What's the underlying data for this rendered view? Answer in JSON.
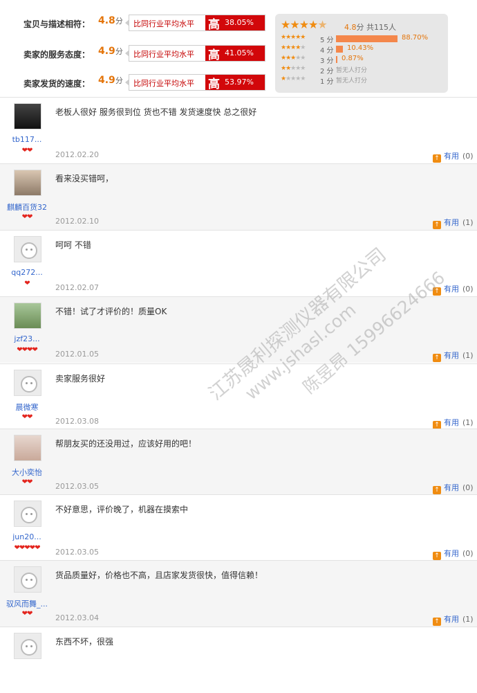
{
  "summary": {
    "metrics": [
      {
        "label": "宝贝与描述相符：",
        "score": "4.8",
        "unit": "分",
        "compare": "比同行业平均水平",
        "level": "高",
        "pct": "38.05%"
      },
      {
        "label": "卖家的服务态度：",
        "score": "4.9",
        "unit": "分",
        "compare": "比同行业平均水平",
        "level": "高",
        "pct": "41.05%"
      },
      {
        "label": "卖家发货的速度：",
        "score": "4.9",
        "unit": "分",
        "compare": "比同行业平均水平",
        "level": "高",
        "pct": "53.97%"
      }
    ],
    "rating": {
      "avg": "4.8",
      "avg_unit": "分",
      "count_text": "共115人",
      "distribution": [
        {
          "label": "5 分",
          "pct": "88.70%",
          "fraction": 0.887,
          "stars": 5
        },
        {
          "label": "4 分",
          "pct": "10.43%",
          "fraction": 0.1043,
          "stars": 4
        },
        {
          "label": "3 分",
          "pct": "0.87%",
          "fraction": 0.0087,
          "stars": 3
        },
        {
          "label": "2 分",
          "pct": "",
          "none": "暂无人打分",
          "fraction": 0,
          "stars": 2
        },
        {
          "label": "1 分",
          "pct": "",
          "none": "暂无人打分",
          "fraction": 0,
          "stars": 1
        }
      ]
    }
  },
  "reviews": [
    {
      "user": "tb117...",
      "hearts": "❤❤",
      "comment": "老板人很好 服务很到位 货也不错 发货速度快 总之很好",
      "date": "2012.02.20",
      "useful_label": "有用",
      "useful_count": "(0)",
      "avatar": "photo-dark"
    },
    {
      "user": "麒麟百货32",
      "hearts": "❤❤",
      "comment": "看来没买错呵，",
      "date": "2012.02.10",
      "useful_label": "有用",
      "useful_count": "(1)",
      "avatar": "photo"
    },
    {
      "user": "qq272...",
      "hearts": "❤",
      "comment": "呵呵 不错",
      "date": "2012.02.07",
      "useful_label": "有用",
      "useful_count": "(0)",
      "avatar": "default"
    },
    {
      "user": "jzf23...",
      "hearts": "❤❤❤❤",
      "comment": "不错！试了才评价的！质量OK",
      "date": "2012.01.05",
      "useful_label": "有用",
      "useful_count": "(1)",
      "avatar": "photo-green"
    },
    {
      "user": "晨微寒",
      "hearts": "❤❤",
      "comment": "卖家服务很好",
      "date": "2012.03.08",
      "useful_label": "有用",
      "useful_count": "(1)",
      "avatar": "default"
    },
    {
      "user": "大小奕怡",
      "hearts": "❤❤",
      "comment": "帮朋友买的还没用过，应该好用的吧！",
      "date": "2012.03.05",
      "useful_label": "有用",
      "useful_count": "(0)",
      "avatar": "photo-baby"
    },
    {
      "user": "jun20...",
      "hearts": "❤❤❤❤❤",
      "comment": "不好意思，评价晚了，机器在摸索中",
      "date": "2012.03.05",
      "useful_label": "有用",
      "useful_count": "(0)",
      "avatar": "default"
    },
    {
      "user": "驭风而舞_...",
      "hearts": "❤❤",
      "comment": "货品质量好，价格也不高，且店家发货很快，值得信赖！",
      "date": "2012.03.04",
      "useful_label": "有用",
      "useful_count": "(1)",
      "avatar": "default"
    },
    {
      "user": "",
      "hearts": "",
      "comment": "东西不坏，很强",
      "date": "",
      "useful_label": "",
      "useful_count": "",
      "avatar": "default"
    }
  ],
  "watermark": {
    "company": "江苏晟利探测仪器有限公司",
    "site": "www.jshasl.com",
    "contact": "陈昱昂 15996624666"
  }
}
